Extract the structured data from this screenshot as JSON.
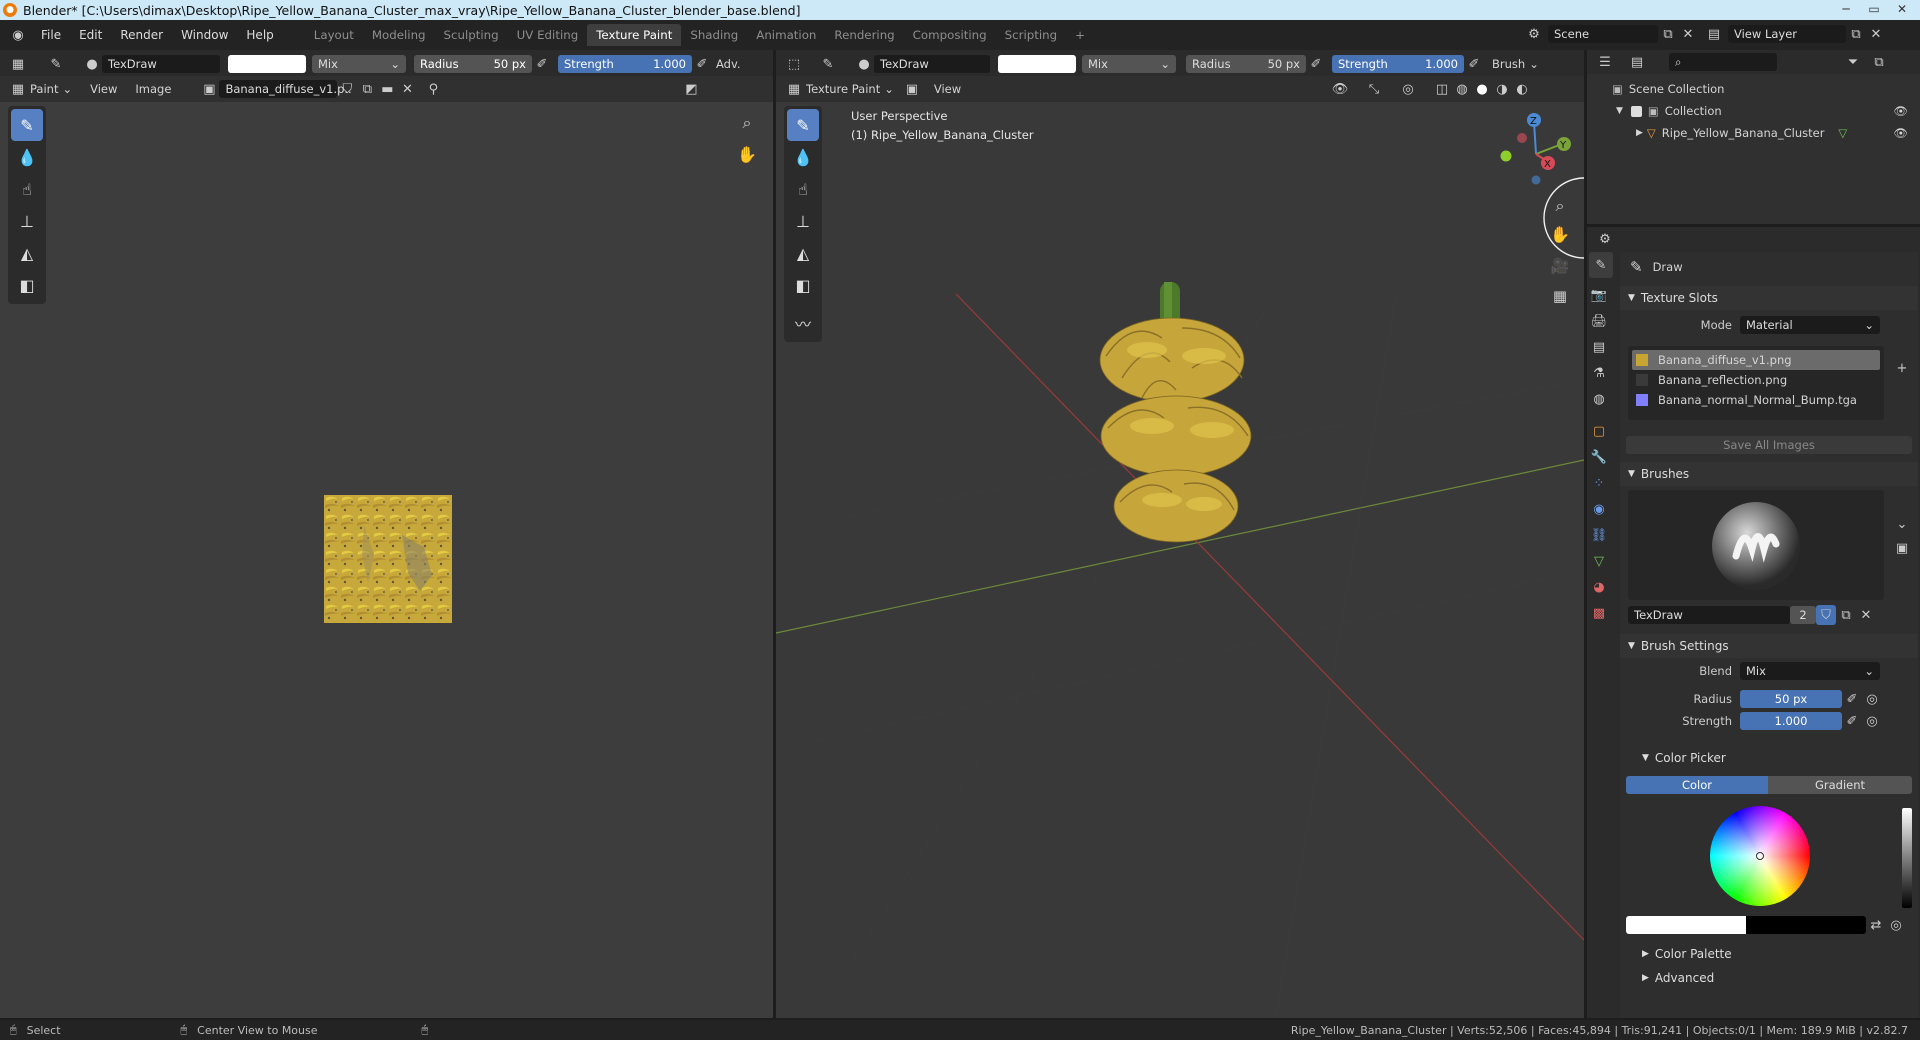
{
  "window": {
    "title": "Blender* [C:\\Users\\dimax\\Desktop\\Ripe_Yellow_Banana_Cluster_max_vray\\Ripe_Yellow_Banana_Cluster_blender_base.blend]"
  },
  "menu": [
    "File",
    "Edit",
    "Render",
    "Window",
    "Help"
  ],
  "workspaces": [
    "Layout",
    "Modeling",
    "Sculpting",
    "UV Editing",
    "Texture Paint",
    "Shading",
    "Animation",
    "Rendering",
    "Compositing",
    "Scripting"
  ],
  "active_workspace": "Texture Paint",
  "top_right": {
    "scene": "Scene",
    "view_layer": "View Layer"
  },
  "image_editor": {
    "tool_header": {
      "brush": "TexDraw",
      "blend": "Mix",
      "radius_label": "Radius",
      "radius_value": "50 px",
      "strength_label": "Strength",
      "strength_value": "1.000",
      "adv": "Adv."
    },
    "header": {
      "mode": "Paint",
      "view": "View",
      "image": "Image",
      "image_name": "Banana_diffuse_v1.p.."
    }
  },
  "viewport": {
    "tool_header": {
      "brush": "TexDraw",
      "blend": "Mix",
      "radius_label": "Radius",
      "radius_value": "50 px",
      "strength_label": "Strength",
      "strength_value": "1.000",
      "brush_menu": "Brush"
    },
    "header": {
      "mode": "Texture Paint",
      "view": "View"
    },
    "overlay_text": {
      "perspective": "User Perspective",
      "object": "(1) Ripe_Yellow_Banana_Cluster"
    },
    "gizmo": {
      "z": "Z",
      "y": "Y",
      "x": "X"
    }
  },
  "outliner": {
    "scene_collection": "Scene Collection",
    "collection": "Collection",
    "object": "Ripe_Yellow_Banana_Cluster"
  },
  "properties": {
    "tool_name": "Draw",
    "texture_slots": {
      "title": "Texture Slots",
      "mode_label": "Mode",
      "mode_value": "Material",
      "slots": [
        {
          "name": "Banana_diffuse_v1.png",
          "color": "#c8a532"
        },
        {
          "name": "Banana_reflection.png",
          "color": "#3a3a3a"
        },
        {
          "name": "Banana_normal_Normal_Bump.tga",
          "color": "#8080ff"
        }
      ],
      "save_all": "Save All Images"
    },
    "brushes": {
      "title": "Brushes",
      "brush_name": "TexDraw",
      "users": "2"
    },
    "brush_settings": {
      "title": "Brush Settings",
      "blend_label": "Blend",
      "blend_value": "Mix",
      "radius_label": "Radius",
      "radius_value": "50 px",
      "strength_label": "Strength",
      "strength_value": "1.000"
    },
    "color_picker": {
      "title": "Color Picker",
      "tab_color": "Color",
      "tab_gradient": "Gradient"
    },
    "color_palette": "Color Palette",
    "advanced": "Advanced"
  },
  "statusbar": {
    "select": "Select",
    "center": "Center View to Mouse",
    "stats": "Ripe_Yellow_Banana_Cluster | Verts:52,506 | Faces:45,894 | Tris:91,241 | Objects:0/1 | Mem: 189.9 MiB | v2.82.7"
  },
  "colors": {
    "accent": "#4772b3",
    "active_tool": "#5680c2",
    "header": "#2b2b2b",
    "editor_bg": "#3d3d3d",
    "viewport_bg": "#393939"
  }
}
